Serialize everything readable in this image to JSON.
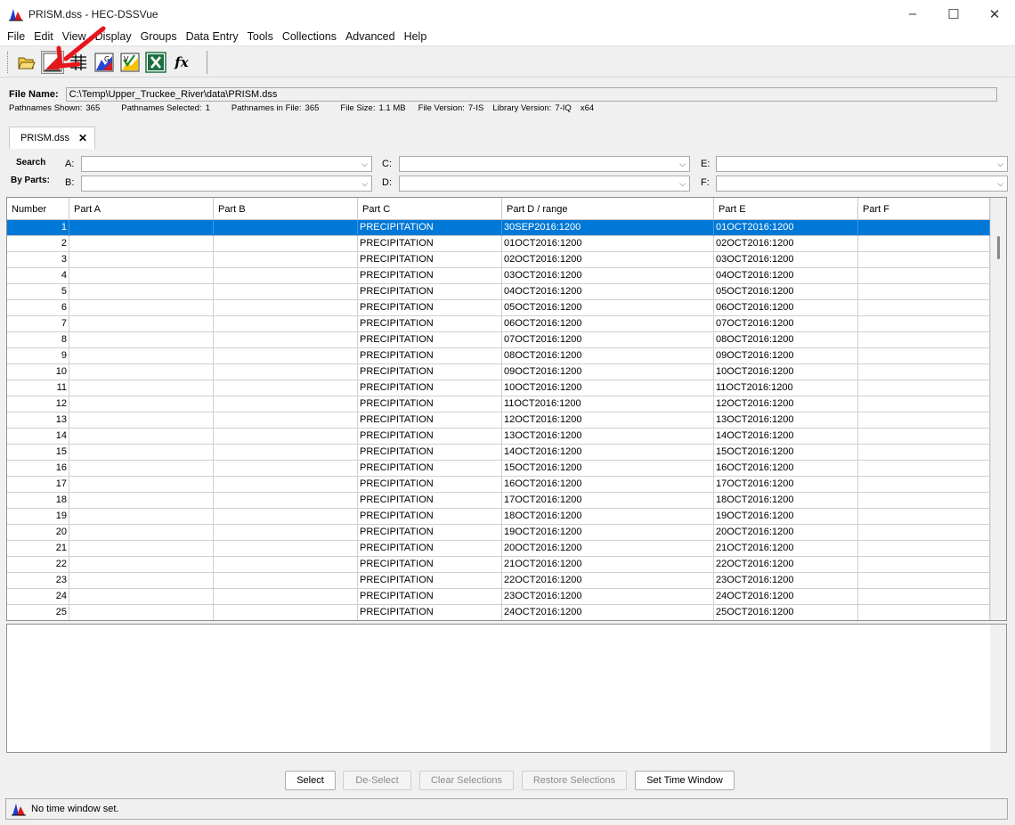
{
  "window": {
    "title": "PRISM.dss - HEC-DSSVue",
    "controls": [
      "–",
      "☐",
      "✕"
    ]
  },
  "menu": [
    "File",
    "Edit",
    "View",
    "Display",
    "Groups",
    "Data Entry",
    "Tools",
    "Collections",
    "Advanced",
    "Help"
  ],
  "toolbar": {
    "buttons": [
      "open-folder-icon",
      "plot-icon",
      "tabulate-icon",
      "graphical-edit-icon",
      "verify-icon",
      "excel-icon",
      "math-functions-icon"
    ],
    "math_label": "fx"
  },
  "file": {
    "name_label": "File Name:",
    "name_value": "C:\\Temp\\Upper_Truckee_River\\data\\PRISM.dss",
    "stats": [
      {
        "label": "Pathnames Shown:",
        "value": "365"
      },
      {
        "label": "Pathnames Selected:",
        "value": "1"
      },
      {
        "label": "Pathnames in File:",
        "value": "365"
      },
      {
        "label": "File Size:",
        "value": "1.1  MB"
      },
      {
        "label": "File Version:",
        "value": "7-IS"
      },
      {
        "label": "Library Version:",
        "value": "7-IQ"
      },
      {
        "label": "",
        "value": "x64"
      }
    ]
  },
  "tab": {
    "label": "PRISM.dss",
    "close": "✕"
  },
  "search": {
    "title_line1": "Search",
    "title_line2": "By Parts:",
    "parts": {
      "a": "A:",
      "b": "B:",
      "c": "C:",
      "d": "D:",
      "e": "E:",
      "f": "F:"
    },
    "dropdown_arrow": "⌵"
  },
  "table": {
    "columns": [
      "Number",
      "Part A",
      "Part B",
      "Part C",
      "Part D / range",
      "Part E",
      "Part F"
    ],
    "rows": [
      [
        "1",
        "",
        "",
        "PRECIPITATION",
        "30SEP2016:1200",
        "01OCT2016:1200",
        ""
      ],
      [
        "2",
        "",
        "",
        "PRECIPITATION",
        "01OCT2016:1200",
        "02OCT2016:1200",
        ""
      ],
      [
        "3",
        "",
        "",
        "PRECIPITATION",
        "02OCT2016:1200",
        "03OCT2016:1200",
        ""
      ],
      [
        "4",
        "",
        "",
        "PRECIPITATION",
        "03OCT2016:1200",
        "04OCT2016:1200",
        ""
      ],
      [
        "5",
        "",
        "",
        "PRECIPITATION",
        "04OCT2016:1200",
        "05OCT2016:1200",
        ""
      ],
      [
        "6",
        "",
        "",
        "PRECIPITATION",
        "05OCT2016:1200",
        "06OCT2016:1200",
        ""
      ],
      [
        "7",
        "",
        "",
        "PRECIPITATION",
        "06OCT2016:1200",
        "07OCT2016:1200",
        ""
      ],
      [
        "8",
        "",
        "",
        "PRECIPITATION",
        "07OCT2016:1200",
        "08OCT2016:1200",
        ""
      ],
      [
        "9",
        "",
        "",
        "PRECIPITATION",
        "08OCT2016:1200",
        "09OCT2016:1200",
        ""
      ],
      [
        "10",
        "",
        "",
        "PRECIPITATION",
        "09OCT2016:1200",
        "10OCT2016:1200",
        ""
      ],
      [
        "11",
        "",
        "",
        "PRECIPITATION",
        "10OCT2016:1200",
        "11OCT2016:1200",
        ""
      ],
      [
        "12",
        "",
        "",
        "PRECIPITATION",
        "11OCT2016:1200",
        "12OCT2016:1200",
        ""
      ],
      [
        "13",
        "",
        "",
        "PRECIPITATION",
        "12OCT2016:1200",
        "13OCT2016:1200",
        ""
      ],
      [
        "14",
        "",
        "",
        "PRECIPITATION",
        "13OCT2016:1200",
        "14OCT2016:1200",
        ""
      ],
      [
        "15",
        "",
        "",
        "PRECIPITATION",
        "14OCT2016:1200",
        "15OCT2016:1200",
        ""
      ],
      [
        "16",
        "",
        "",
        "PRECIPITATION",
        "15OCT2016:1200",
        "16OCT2016:1200",
        ""
      ],
      [
        "17",
        "",
        "",
        "PRECIPITATION",
        "16OCT2016:1200",
        "17OCT2016:1200",
        ""
      ],
      [
        "18",
        "",
        "",
        "PRECIPITATION",
        "17OCT2016:1200",
        "18OCT2016:1200",
        ""
      ],
      [
        "19",
        "",
        "",
        "PRECIPITATION",
        "18OCT2016:1200",
        "19OCT2016:1200",
        ""
      ],
      [
        "20",
        "",
        "",
        "PRECIPITATION",
        "19OCT2016:1200",
        "20OCT2016:1200",
        ""
      ],
      [
        "21",
        "",
        "",
        "PRECIPITATION",
        "20OCT2016:1200",
        "21OCT2016:1200",
        ""
      ],
      [
        "22",
        "",
        "",
        "PRECIPITATION",
        "21OCT2016:1200",
        "22OCT2016:1200",
        ""
      ],
      [
        "23",
        "",
        "",
        "PRECIPITATION",
        "22OCT2016:1200",
        "23OCT2016:1200",
        ""
      ],
      [
        "24",
        "",
        "",
        "PRECIPITATION",
        "23OCT2016:1200",
        "24OCT2016:1200",
        ""
      ],
      [
        "25",
        "",
        "",
        "PRECIPITATION",
        "24OCT2016:1200",
        "25OCT2016:1200",
        ""
      ]
    ],
    "selected_row": 0
  },
  "actions": {
    "select": "Select",
    "deselect": "De-Select",
    "clear": "Clear Selections",
    "restore": "Restore Selections",
    "time_window": "Set Time Window"
  },
  "status": {
    "text": "No time window set."
  },
  "colors": {
    "selection": "#0078d7",
    "annotation_arrow": "#e8141b"
  }
}
